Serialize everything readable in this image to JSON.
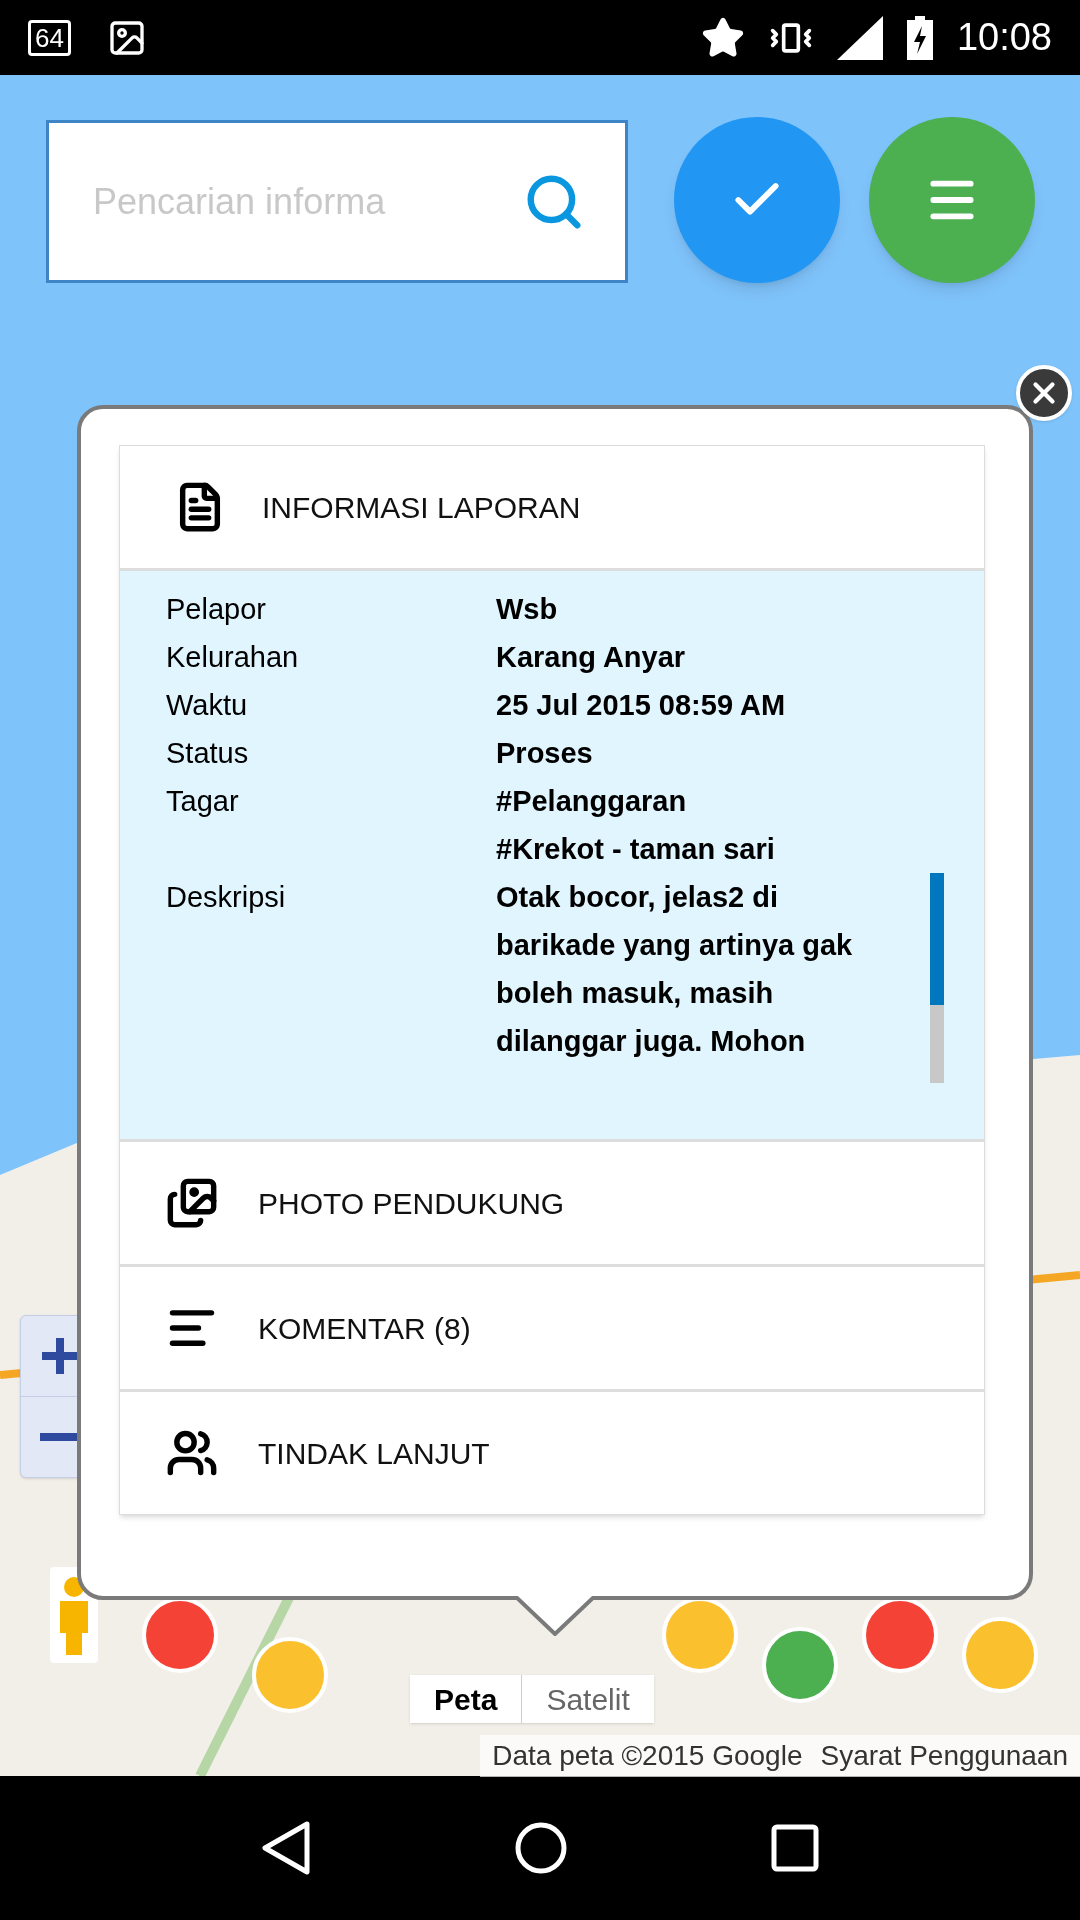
{
  "status_bar": {
    "notification_badge": "64",
    "time": "10:08"
  },
  "search": {
    "placeholder": "Pencarian informa"
  },
  "popup": {
    "header": "INFORMASI LAPORAN",
    "fields": [
      {
        "kind": "text",
        "label": "Pelapor",
        "value": "Wsb"
      },
      {
        "kind": "text",
        "label": "Kelurahan",
        "value": "Karang Anyar"
      },
      {
        "kind": "text",
        "label": "Waktu",
        "value": "25 Jul 2015 08:59 AM"
      },
      {
        "kind": "text",
        "label": "Status",
        "value": "Proses"
      },
      {
        "kind": "tags",
        "label": "Tagar",
        "values": [
          "#Pelanggaran",
          "#Krekot - taman sari"
        ]
      },
      {
        "kind": "paragraph",
        "label": "Deskripsi",
        "value": "Otak bocor, jelas2 di barikade yang artinya gak boleh masuk, masih dilanggar juga. Mohon"
      }
    ],
    "sections": [
      {
        "kind": "photos",
        "label": "PHOTO PENDUKUNG"
      },
      {
        "kind": "comments",
        "label": "KOMENTAR (8)"
      },
      {
        "kind": "followup",
        "label": "TINDAK LANJUT"
      }
    ]
  },
  "map_controls": {
    "map_types": [
      {
        "label": "Peta",
        "selected": true
      },
      {
        "label": "Satelit",
        "selected": false
      }
    ],
    "attribution": "Data peta ©2015 Google",
    "terms": "Syarat Penggunaan"
  }
}
